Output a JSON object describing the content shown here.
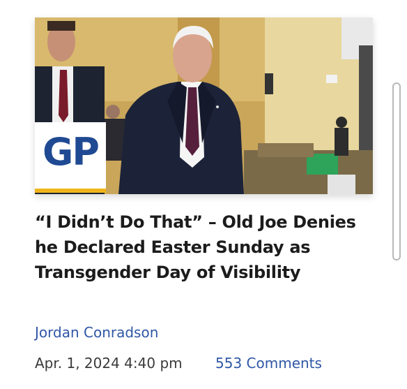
{
  "article": {
    "logo_text": "GP",
    "headline": "“I Didn’t Do That” – Old Joe Denies he Declared Easter Sunday as Transgender Day of Visibility",
    "author": "Jordan Conradson",
    "date": "Apr. 1, 2024 4:40 pm",
    "comments": "553 Comments"
  },
  "colors": {
    "logo_blue": "#1f4a93",
    "logo_gold": "#f0b51b",
    "link_blue": "#2f57a6",
    "headline_text": "#1c1c1c"
  }
}
